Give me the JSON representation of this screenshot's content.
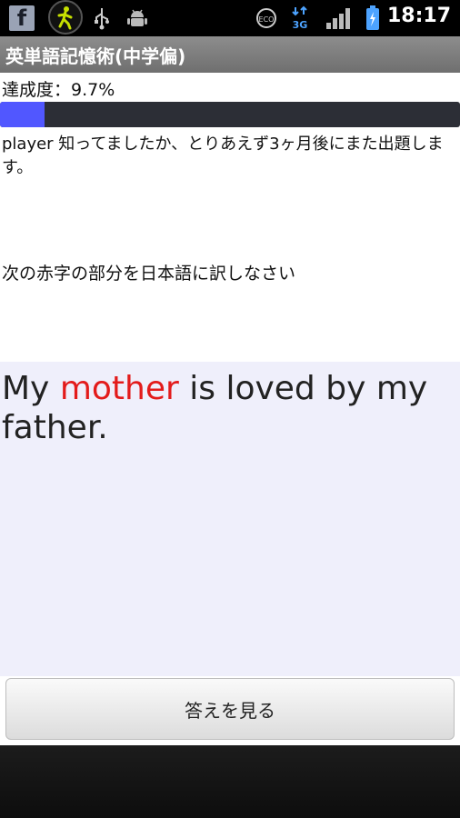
{
  "status_bar": {
    "time": "18:17",
    "icons": [
      "facebook-icon",
      "running-man-icon",
      "usb-icon",
      "android-debug-icon",
      "eco-icon",
      "3g-icon",
      "signal-icon",
      "battery-icon"
    ],
    "network": "3G",
    "eco": "ECO"
  },
  "app": {
    "title": "英単語記憶術(中学偏)"
  },
  "progress": {
    "label": "達成度：9.7%",
    "value": 0.097,
    "fill_color": "#5157ff",
    "track_color": "#2c2e36"
  },
  "message": "player 知ってましたか、とりあえず3ヶ月後にまた出題します。",
  "instruction": "次の赤字の部分を日本語に訳しなさい",
  "sentence": {
    "before": "My ",
    "highlight": "mother",
    "after": " is loved by my father.",
    "highlight_color": "#e31b1b"
  },
  "answer_button": {
    "label": "答えを見る"
  }
}
